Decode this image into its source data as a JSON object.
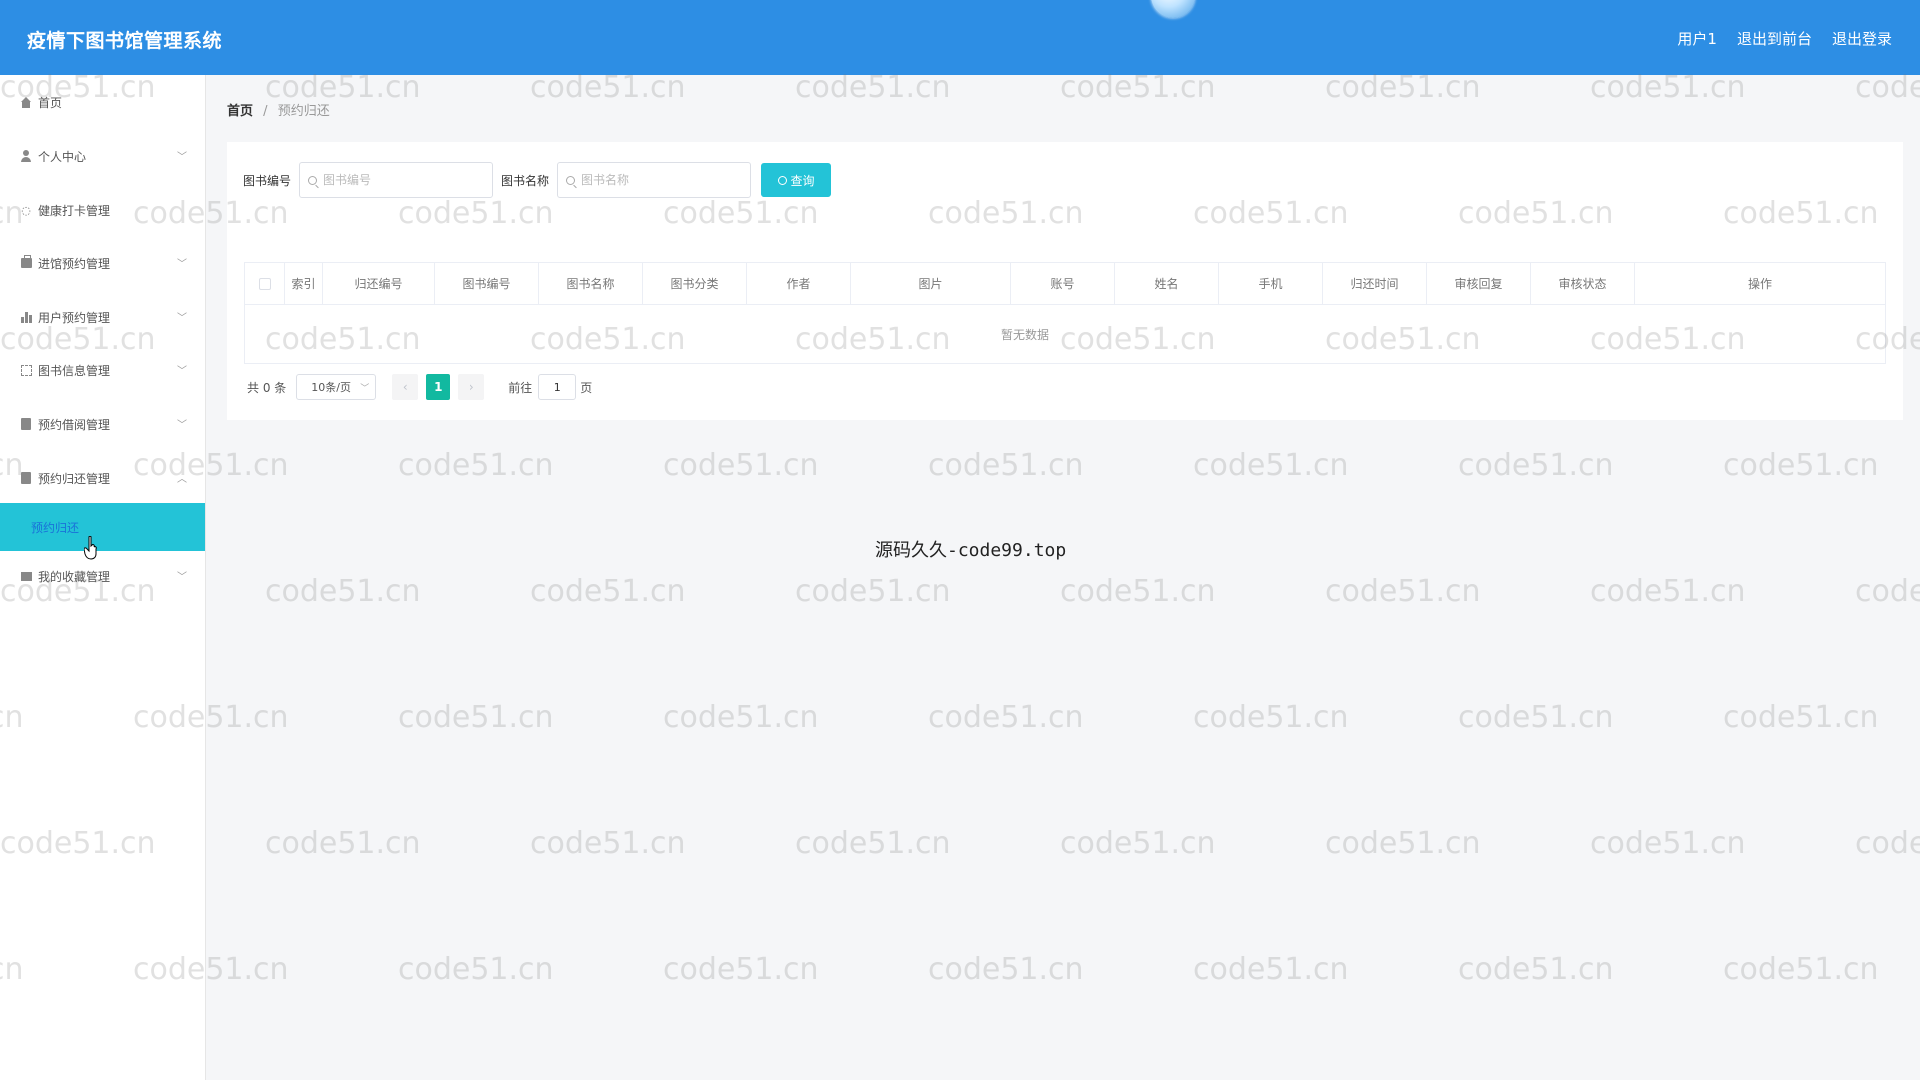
{
  "header": {
    "title": "疫情下图书馆管理系统",
    "user": "用户1",
    "to_front": "退出到前台",
    "logout": "退出登录"
  },
  "sidebar": {
    "items": [
      {
        "label": "首页",
        "icon": "home-icon"
      },
      {
        "label": "个人中心",
        "icon": "user-icon"
      },
      {
        "label": "健康打卡管理",
        "icon": "health-icon"
      },
      {
        "label": "进馆预约管理",
        "icon": "bag-icon"
      },
      {
        "label": "用户预约管理",
        "icon": "chart-icon"
      },
      {
        "label": "图书信息管理",
        "icon": "frame-icon"
      },
      {
        "label": "预约借阅管理",
        "icon": "clipboard-icon"
      },
      {
        "label": "预约归还管理",
        "icon": "clipboard-icon"
      },
      {
        "label": "我的收藏管理",
        "icon": "monitor-icon"
      }
    ],
    "active_sub": "预约归还"
  },
  "breadcrumb": {
    "home": "首页",
    "separator": "/",
    "current": "预约归还"
  },
  "search": {
    "book_no_label": "图书编号",
    "book_no_placeholder": "图书编号",
    "book_name_label": "图书名称",
    "book_name_placeholder": "图书名称",
    "query_button": "查询"
  },
  "table": {
    "columns": [
      "索引",
      "归还编号",
      "图书编号",
      "图书名称",
      "图书分类",
      "作者",
      "图片",
      "账号",
      "姓名",
      "手机",
      "归还时间",
      "审核回复",
      "审核状态",
      "操作"
    ],
    "empty_text": "暂无数据"
  },
  "pagination": {
    "total": "共 0 条",
    "page_size": "10条/页",
    "current_page": "1",
    "goto_label": "前往",
    "goto_value": "1",
    "page_unit": "页"
  },
  "watermark": {
    "text": "code51.cn",
    "center": "源码久久-code99.top"
  },
  "colors": {
    "header": "#2d8ee4",
    "accent": "#23c3d7",
    "page_active": "#12b9a0"
  }
}
